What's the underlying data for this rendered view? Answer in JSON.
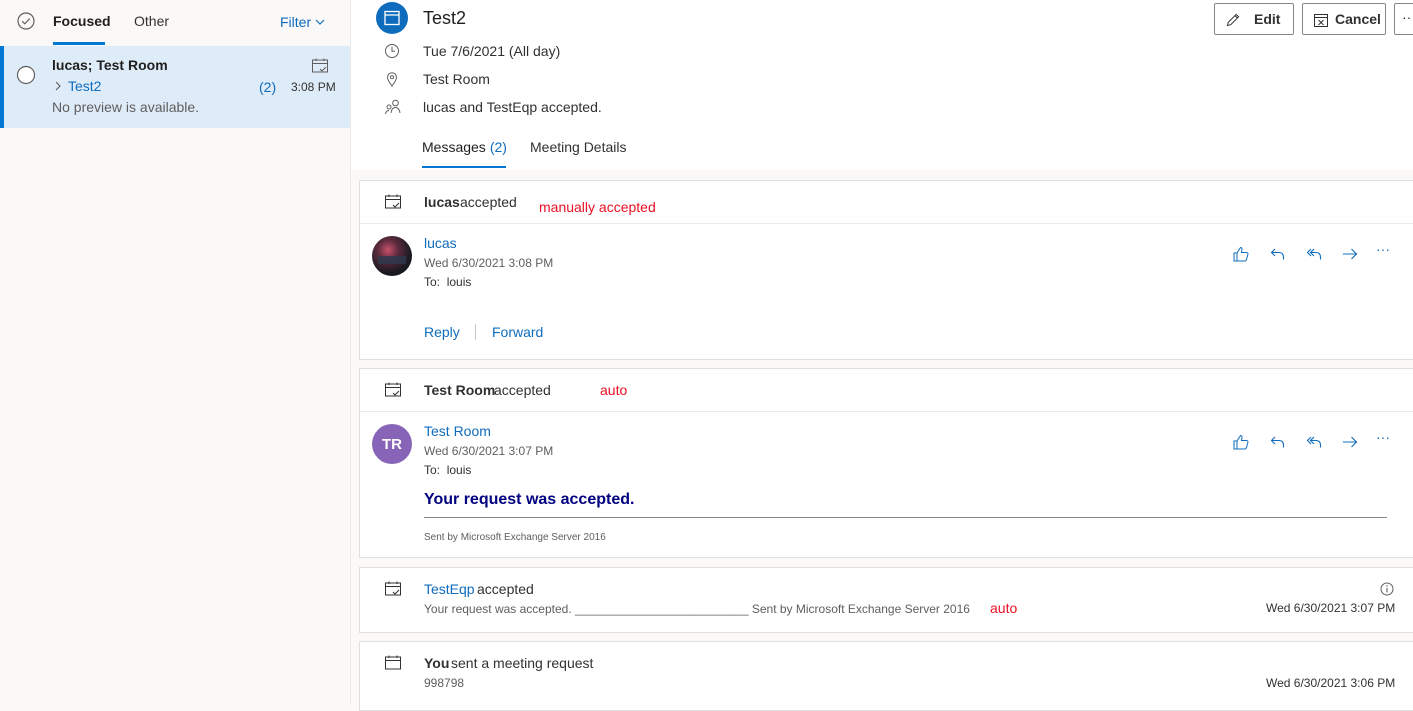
{
  "list": {
    "tabs": {
      "focused": "Focused",
      "other": "Other"
    },
    "filter": "Filter",
    "item": {
      "senders": "lucas; Test Room",
      "subject": "Test2",
      "count": "(2)",
      "time": "3:08 PM",
      "preview": "No preview is available."
    }
  },
  "event": {
    "title": "Test2",
    "date": "Tue 7/6/2021 (All day)",
    "location": "Test Room",
    "attendees": "lucas and TestEqp accepted.",
    "edit": "Edit",
    "cancel": "Cancel",
    "more": "···"
  },
  "tabs": {
    "messages": "Messages",
    "messages_count": "(2)",
    "details": "Meeting Details"
  },
  "cards": {
    "c1": {
      "sender_bold": "lucas",
      "status": "accepted",
      "annotation": "manually accepted",
      "from": "lucas",
      "date": "Wed 6/30/2021 3:08 PM",
      "to_label": "To:",
      "to": "louis",
      "reply": "Reply",
      "forward": "Forward"
    },
    "c2": {
      "sender_bold": "Test Room",
      "status": "accepted",
      "annotation": "auto",
      "avatar": "TR",
      "from": "Test Room",
      "date": "Wed 6/30/2021 3:07 PM",
      "to_label": "To:",
      "to": "louis",
      "body": "Your request was accepted.",
      "footer": "Sent by Microsoft Exchange Server 2016"
    },
    "c3": {
      "sender": "TestEqp",
      "status": "accepted",
      "preview": "Your request was accepted. __________________________ Sent by Microsoft Exchange Server 2016",
      "annotation": "auto",
      "date": "Wed 6/30/2021 3:07 PM"
    },
    "c4": {
      "sender_bold": "You",
      "status": "sent a meeting request",
      "preview": "998798",
      "date": "Wed 6/30/2021 3:06 PM"
    }
  },
  "colors": {
    "accent": "#0078d4",
    "selected_bg": "#deecf9",
    "annotation_red": "#e81123",
    "avatar_purple": "#8764b8",
    "body_navy": "#000080"
  },
  "icons": [
    "check-circle-icon",
    "chevron-down-icon",
    "calendar-icon",
    "clock-icon",
    "location-icon",
    "people-icon",
    "pencil-icon",
    "calendar-cancel-icon",
    "like-icon",
    "reply-icon",
    "reply-all-icon",
    "forward-icon",
    "more-icon",
    "info-icon",
    "radio-circle-icon",
    "chevron-right-icon"
  ]
}
